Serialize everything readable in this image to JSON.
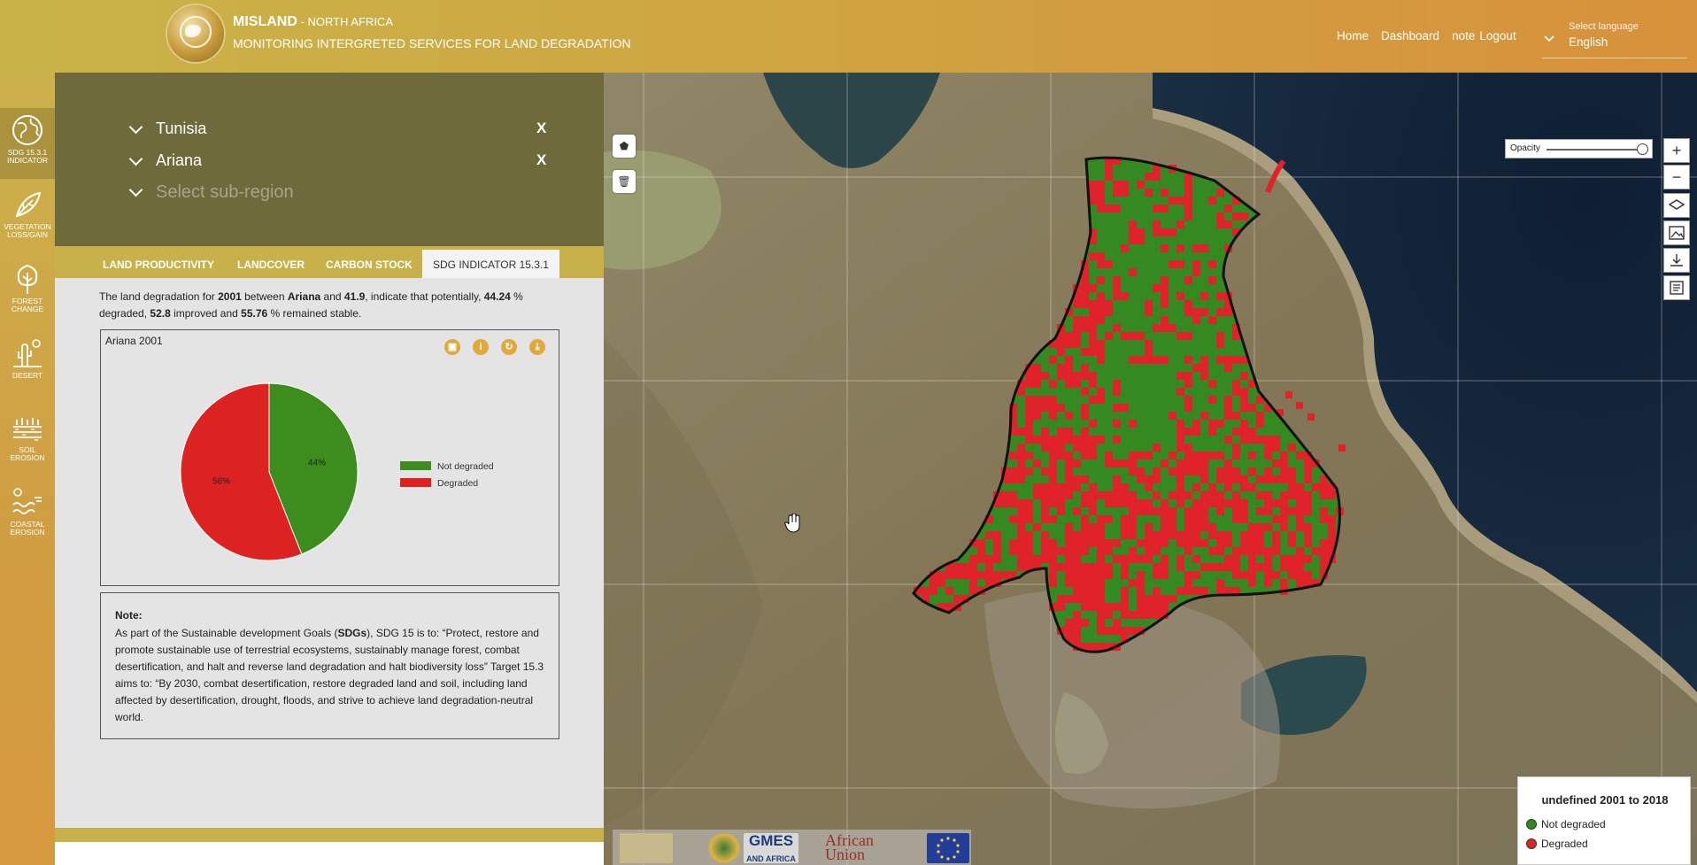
{
  "header": {
    "brand": "MISLAND",
    "region": " - NORTH AFRICA",
    "tagline": "MONITORING INTERGRETED SERVICES FOR LAND DEGRADATION",
    "nav": [
      "Home",
      "Dashboard",
      "note",
      "Logout"
    ],
    "language_label": "Select language",
    "language_value": "English"
  },
  "sidebar": {
    "items": [
      {
        "label": "SDG 15.3.1 INDICATOR",
        "icon": "globe-icon",
        "active": true
      },
      {
        "label": "VEGETATION LOSS/GAIN",
        "icon": "leaf-icon",
        "active": false
      },
      {
        "label": "FOREST CHANGE",
        "icon": "tree-icon",
        "active": false
      },
      {
        "label": "DESERT",
        "icon": "cactus-icon",
        "active": false
      },
      {
        "label": "SOIL EROSION",
        "icon": "soil-icon",
        "active": false
      },
      {
        "label": "COASTAL EROSION",
        "icon": "coast-icon",
        "active": false
      }
    ]
  },
  "region_select": {
    "country": "Tunisia",
    "region": "Ariana",
    "subregion_placeholder": "Select sub-region",
    "clear": "X"
  },
  "tabs": [
    {
      "label": "LAND PRODUCTIVITY",
      "active": false
    },
    {
      "label": "LANDCOVER",
      "active": false
    },
    {
      "label": "CARBON STOCK",
      "active": false
    },
    {
      "label": "SDG INDICATOR 15.3.1",
      "active": true
    }
  ],
  "summary": {
    "t1": "The land degradation for ",
    "year": "2001",
    "t2": " between ",
    "region": "Ariana",
    "t3": " and ",
    "v1": "41.9",
    "t4": ", indicate that potentially, ",
    "degraded_pct": "44.24",
    "t5": " % degraded, ",
    "improved": "52.8",
    "t6": " improved and ",
    "stable_pct": "55.76",
    "t7": " % remained stable."
  },
  "chart": {
    "title": "Ariana 2001",
    "tools": [
      "image-icon",
      "info-icon",
      "refresh-icon",
      "download-icon"
    ]
  },
  "chart_data": {
    "type": "pie",
    "title": "Ariana 2001",
    "series": [
      {
        "name": "Not degraded",
        "value": 44,
        "label": "44%",
        "color": "#3c8c1e"
      },
      {
        "name": "Degraded",
        "value": 56,
        "label": "56%",
        "color": "#dd2222"
      }
    ]
  },
  "note": {
    "title": "Note:",
    "p1": "As part of the Sustainable development Goals (",
    "sdgs": "SDGs",
    "p2": "), SDG 15 is to: “Protect, restore and promote sustainable use of terrestrial ecosystems, sustainably manage forest, combat desertification, and halt and reverse land degradation and halt biodiversity loss” Target 15.3 aims to: “By 2030, combat desertification, restore degraded land and soil, including land affected by desertification, drought, floods, and strive to achieve land degradation-neutral world."
  },
  "map": {
    "opacity_label": "Opacity",
    "opacity_value": 1.0,
    "legend_title": "undefined 2001 to 2018",
    "legend": [
      {
        "label": "Not degraded",
        "color": "#2d8a1c"
      },
      {
        "label": "Degraded",
        "color": "#e02424"
      }
    ],
    "controls": [
      "zoom-in-icon",
      "zoom-out-icon",
      "layers-icon",
      "image-icon",
      "download-icon",
      "document-icon"
    ],
    "draw_tools": [
      "polygon-icon",
      "trash-icon"
    ],
    "partners": [
      "misland-logo",
      "au-logo",
      "gmes-and-africa-logo",
      "african-union-logo",
      "eu-flag-logo"
    ],
    "partner_text": {
      "gmes": "GMES",
      "gmes_sub": "AND AFRICA",
      "au": "African Union"
    }
  }
}
